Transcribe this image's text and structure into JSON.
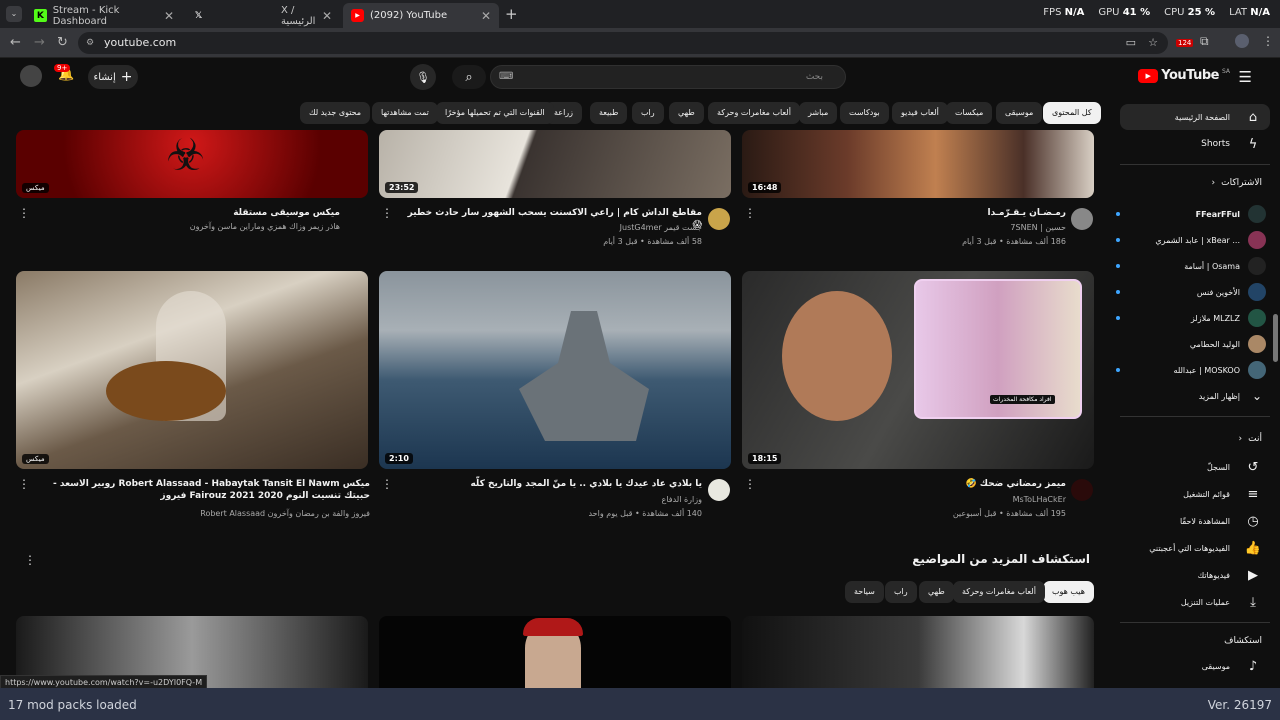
{
  "browser": {
    "tabs": [
      {
        "label": "Stream - Kick Dashboard"
      },
      {
        "label": "X / الرئيسية"
      },
      {
        "label": "(2092) YouTube"
      }
    ],
    "url": "youtube.com",
    "perf": {
      "fps_label": "FPS",
      "fps": "N/A",
      "gpu_label": "GPU",
      "gpu": "41 %",
      "cpu_label": "CPU",
      "cpu": "25 %",
      "lat_label": "LAT",
      "lat": "N/A"
    },
    "ext_badge": "124"
  },
  "youtube": {
    "logo": "YouTube",
    "region": "SA",
    "search_placeholder": "بحث",
    "create_label": "إنشاء",
    "notif_count": "9+",
    "chips": [
      "كل المحتوى",
      "موسيقى",
      "ميكسات",
      "ألعاب فيديو",
      "بودكاست",
      "مباشر",
      "ألعاب مغامرات وحركة",
      "طهي",
      "راب",
      "طبيعة",
      "زراعة",
      "القنوات التي تم تحميلها مؤخرًا",
      "تمت مشاهدتها",
      "محتوى جديد لك"
    ],
    "sidebar": {
      "home": "الصفحة الرئيسية",
      "shorts": "Shorts",
      "subs_header": "الاشتراكات",
      "subscriptions": [
        "FFearFFul",
        "عابد الشمري | xBear ...",
        "أسامة | Osama",
        "الأخوين فنس",
        "ملازلز MLZLZ",
        "الوليد الحطامي",
        "عبدالله | MOSKOO"
      ],
      "show_more": "إظهار المزيد",
      "you_header": "أنت",
      "you": [
        "السجلّ",
        "قوائم التشغيل",
        "المشاهدة لاحقًا",
        "الفيديوهات التي أعجبتني",
        "فيديوهاتك",
        "عمليات التنزيل"
      ],
      "explore_header": "استكشاف",
      "music": "موسيقى"
    },
    "videos": [
      {
        "title": "ميكس موسيقى مستقلة",
        "meta1": "هاذر زيمر وزاك همزي وماراين ماسن وآخرون",
        "mix": "ميكس"
      },
      {
        "title": "مقاطع الداش كام | راعي الاكسنت يسحب الشهور سار حادث خطير 😱",
        "channel": "جست قيمر JustG4mer",
        "meta": "58 ألف مشاهدة • قبل 3 أيام",
        "duration": "23:52"
      },
      {
        "title": "رمـضـان يـقـرّمـدا",
        "channel": "حسين | 7SNEN",
        "meta": "186 ألف مشاهدة • قبل 3 أيام",
        "duration": "16:48"
      },
      {
        "title": "ميكس Robert Alassaad - Habaytak Tansit El Nawm روبير الاسعد - حبيتك تنسيت النوم Fairouz 2021 2020 فيروز",
        "meta1": "فيروز والفة بن رمضان وآخرون Robert Alassaad",
        "mix": "ميكس"
      },
      {
        "title": "يا بلادي عاد عيدك يا بلادي .. يا منّ المجد والتاريخ كلّه",
        "channel": "وزارة الدفاع",
        "meta": "140 ألف مشاهدة • قبل يوم واحد",
        "duration": "2:10"
      },
      {
        "title": "ميمز رمضاني ضحك 🤣",
        "channel": "MsToLHaCkEr",
        "meta": "195 ألف مشاهدة • قبل أسبوعين",
        "duration": "18:15"
      }
    ],
    "explore": {
      "title": "استكشاف المزيد من المواضيع",
      "chips": [
        "هيب هوب",
        "ألعاب مغامرات وحركة",
        "طهي",
        "راب",
        "سياحة"
      ]
    },
    "thumb_text": {
      "badge": "افراد مكافحة المخدرات"
    }
  },
  "status_url": "https://www.youtube.com/watch?v=-u2DYI0FQ-M",
  "overlay": {
    "left": "17 mod packs loaded",
    "right": "Ver. 26197"
  }
}
